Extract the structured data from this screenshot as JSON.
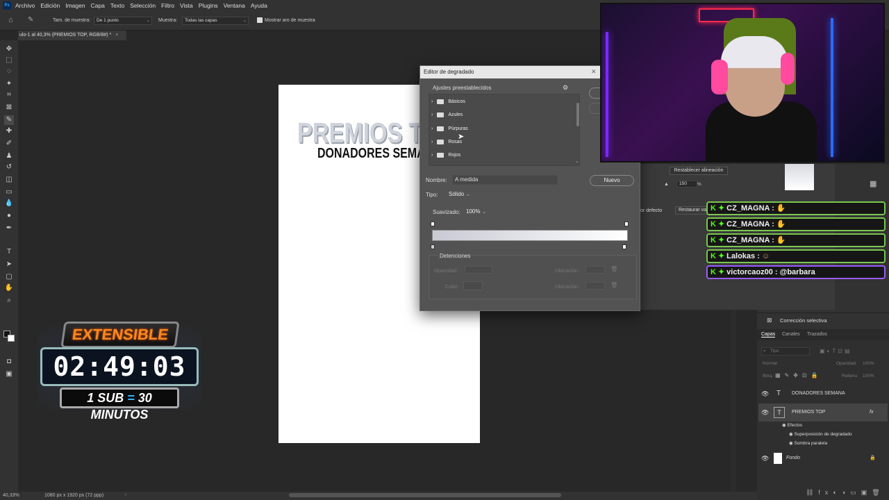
{
  "menubar": {
    "items": [
      "Archivo",
      "Edición",
      "Imagen",
      "Capa",
      "Texto",
      "Selección",
      "Filtro",
      "Vista",
      "Plugins",
      "Ventana",
      "Ayuda"
    ]
  },
  "options": {
    "sample_size_label": "Tam. de muestra:",
    "sample_size_value": "De 1 punto",
    "sample_label": "Muestra:",
    "sample_value": "Todas las capas",
    "show_ring_label": "Mostrar aro de muestra"
  },
  "document": {
    "tab_title": "ulo-1 al 40,3% (PREMIOS TOP, RGB/8#) *",
    "text_premios": "PREMIOS T",
    "text_donadores": "DONADORES SEMA"
  },
  "status": {
    "zoom": "40,33%",
    "size": "1080 px x 1920 px (72 ppp)"
  },
  "dialog": {
    "title": "Editor de degradado",
    "presets_label": "Ajustes preestablecidos",
    "folders": [
      "Básicos",
      "Azules",
      "Púrpuras",
      "Rosas",
      "Rojos"
    ],
    "name_label": "Nombre:",
    "name_value": "A medida",
    "new_button": "Nuevo",
    "type_label": "Tipo:",
    "type_value": "Sólido",
    "smooth_label": "Suavizado:",
    "smooth_value": "100%",
    "stops_label": "Detenciones",
    "opacity_label": "Opacidad:",
    "location_label": "Ubicación:",
    "color_label": "Color:",
    "location_label_2": "Ubicación:",
    "gradient_colors": [
      "#c8cad4",
      "#ffffff"
    ]
  },
  "behind_dialog": {
    "reset_align": "Restablecer alineación",
    "scale_value": "150",
    "scale_unit": "%",
    "default_label": "or defecto",
    "restore_label": "Restaurar val",
    "selective_correction": "Corrección selectiva"
  },
  "layers_panel": {
    "tabs": [
      "Capas",
      "Canales",
      "Trazados"
    ],
    "search_placeholder": "Tipo",
    "blend_mode": "Normal",
    "opacity_label": "Opacidad:",
    "opacity_value": "100%",
    "lock_label": "Bloq.:",
    "fill_label": "Relleno:",
    "fill_value": "100%",
    "layers": [
      {
        "name": "DONADORES SEMANA",
        "type": "text"
      },
      {
        "name": "PREMIOS TOP",
        "type": "text",
        "fx": "fx"
      },
      {
        "name": "Fondo",
        "type": "image"
      }
    ],
    "effects_label": "Efectos",
    "effects": [
      "Superposición de degradado",
      "Sombra paralela"
    ]
  },
  "chat": {
    "messages": [
      {
        "user": "CZ_MAGNA :",
        "text": ""
      },
      {
        "user": "CZ_MAGNA :",
        "text": ""
      },
      {
        "user": "CZ_MAGNA :",
        "text": ""
      },
      {
        "user": "Lalokas :",
        "text": ""
      },
      {
        "user": "victorcaoz00 :",
        "text": "@barbara"
      }
    ]
  },
  "timer": {
    "badge": "EXTENSIBLE",
    "time": "02:49:03",
    "sub_left": "1 SUB",
    "sub_eq": "=",
    "sub_right": "30 MINUTOS"
  }
}
